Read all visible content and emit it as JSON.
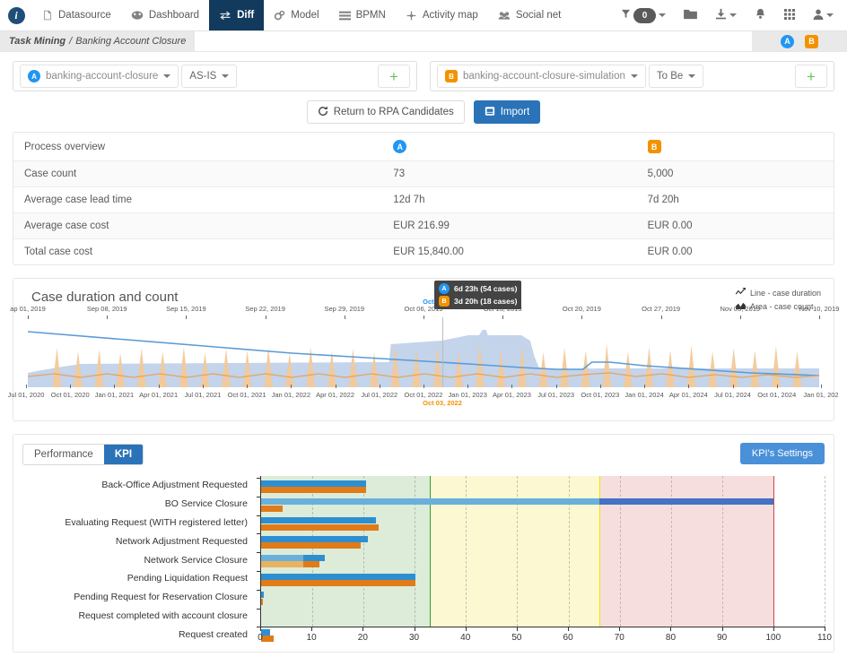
{
  "nav": {
    "logo_icon": "info-circle-icon",
    "items": [
      {
        "label": "Datasource",
        "icon": "file-icon",
        "active": false
      },
      {
        "label": "Dashboard",
        "icon": "dashboard-icon",
        "active": false
      },
      {
        "label": "Diff",
        "icon": "diff-arrows-icon",
        "active": true
      },
      {
        "label": "Model",
        "icon": "gears-icon",
        "active": false
      },
      {
        "label": "BPMN",
        "icon": "bpmn-icon",
        "active": false
      },
      {
        "label": "Activity map",
        "icon": "activity-map-icon",
        "active": false
      },
      {
        "label": "Social net",
        "icon": "social-net-icon",
        "active": false
      }
    ],
    "right": [
      {
        "name": "filter-icon",
        "label": "0"
      },
      {
        "name": "folder-icon",
        "label": ""
      },
      {
        "name": "download-icon",
        "label": ""
      },
      {
        "name": "bell-icon",
        "label": ""
      },
      {
        "name": "grid-apps-icon",
        "label": ""
      },
      {
        "name": "user-icon",
        "label": ""
      }
    ]
  },
  "breadcrumb": {
    "root": "Task Mining",
    "separator": "/",
    "current": "Banking Account Closure",
    "badge_a": "A",
    "badge_b": "B"
  },
  "selectors": {
    "left": {
      "badge": "A",
      "dataset": "banking-account-closure",
      "version": "AS-IS",
      "add_label": "+"
    },
    "right": {
      "badge": "B",
      "dataset": "banking-account-closure-simulation",
      "version": "To Be",
      "add_label": "+"
    }
  },
  "actions": {
    "return_label": "Return to RPA Candidates",
    "return_icon": "refresh-icon",
    "import_label": "Import",
    "import_icon": "import-inbox-icon"
  },
  "overview": {
    "title": "Process overview",
    "col_a": "A",
    "col_b": "B",
    "rows": [
      {
        "label": "Case count",
        "a": "73",
        "b": "5,000"
      },
      {
        "label": "Average case lead time",
        "a": "12d 7h",
        "b": "7d 20h"
      },
      {
        "label": "Average case cost",
        "a": "EUR 216.99",
        "b": "EUR 0.00"
      },
      {
        "label": "Total case cost",
        "a": "EUR 15,840.00",
        "b": "EUR 0.00"
      }
    ]
  },
  "duration_chart": {
    "title": "Case duration and count",
    "legend": [
      {
        "icon": "line-chart-icon",
        "label": "Line - case duration"
      },
      {
        "icon": "area-chart-icon",
        "label": "Area - case count"
      }
    ],
    "tooltip": {
      "a_badge": "A",
      "a_value": "6d 23h (54 cases)",
      "b_badge": "B",
      "b_value": "3d 20h (18 cases)"
    },
    "hover_top_label": "Oct 07, 2019",
    "hover_bottom_label": "Oct 03, 2022",
    "axis_top": [
      "ap 01, 2019",
      "Sep 08, 2019",
      "Sep 15, 2019",
      "Sep 22, 2019",
      "Sep 29, 2019",
      "Oct 06, 2019",
      "Oct 13, 2019",
      "Oct 20, 2019",
      "Oct 27, 2019",
      "Nov 03, 2019",
      "Nov 10, 2019"
    ],
    "axis_bottom": [
      "Jul 01, 2020",
      "Oct 01, 2020",
      "Jan 01, 2021",
      "Apr 01, 2021",
      "Jul 01, 2021",
      "Oct 01, 2021",
      "Jan 01, 2022",
      "Apr 01, 2022",
      "Jul 01, 2022",
      "Oct 01, 2022",
      "Jan 01, 2023",
      "Apr 01, 2023",
      "Jul 01, 2023",
      "Oct 01, 2023",
      "Jan 01, 2024",
      "Apr 01, 2024",
      "Jul 01, 2024",
      "Oct 01, 2024",
      "Jan 01, 202"
    ]
  },
  "kpi": {
    "tabs": [
      {
        "label": "Performance",
        "active": false
      },
      {
        "label": "KPI",
        "active": true
      }
    ],
    "settings_label": "KPI's Settings"
  },
  "chart_data": {
    "type": "bar",
    "title": "KPI",
    "xlabel": "",
    "ylabel": "",
    "xlim": [
      0,
      110
    ],
    "xticks": [
      0,
      10,
      20,
      30,
      40,
      50,
      60,
      70,
      80,
      90,
      100,
      110
    ],
    "grid": true,
    "orientation": "horizontal",
    "legend": [],
    "bands": [
      {
        "name": "green",
        "from": 0,
        "to": 33,
        "color": "#dcecd9"
      },
      {
        "name": "yellow",
        "from": 33,
        "to": 66,
        "color": "#fbf8d2"
      },
      {
        "name": "red",
        "from": 66,
        "to": 100,
        "color": "#f7dede"
      }
    ],
    "band_edges": [
      {
        "at": 33,
        "color": "#2f9e2f"
      },
      {
        "at": 66,
        "color": "#e6e600"
      },
      {
        "at": 100,
        "color": "#c94b4b"
      }
    ],
    "categories": [
      "Back-Office Adjustment Requested",
      "BO Service Closure",
      "Evaluating Request (WITH registered letter)",
      "Network Adjustment Requested",
      "Network Service Closure",
      "Pending Liquidation Request",
      "Pending Request for Reservation Closure",
      "Request completed with account closure",
      "Request created"
    ],
    "series": [
      {
        "name": "A",
        "color": "#2e8fd0",
        "values": [
          20.5,
          100,
          22.5,
          20.8,
          12.5,
          30.2,
          0.5,
          0,
          1.8
        ]
      },
      {
        "name": "B",
        "color": "#e07b18",
        "values": [
          20.5,
          4.2,
          22.9,
          19.5,
          11.4,
          30.1,
          0.4,
          0,
          2.4
        ]
      }
    ],
    "overlay_segments": [
      {
        "category": "BO Service Closure",
        "series": "A",
        "from": 0,
        "to": 66,
        "color": "#6ab0dc"
      },
      {
        "category": "BO Service Closure",
        "series": "A",
        "from": 66,
        "to": 100,
        "color": "#4472c4"
      },
      {
        "category": "Network Service Closure",
        "series": "A",
        "from": 0,
        "to": 8.3,
        "color": "#6ab0dc"
      },
      {
        "category": "Network Service Closure",
        "series": "B",
        "from": 0,
        "to": 8.3,
        "color": "#e8b261"
      }
    ]
  }
}
